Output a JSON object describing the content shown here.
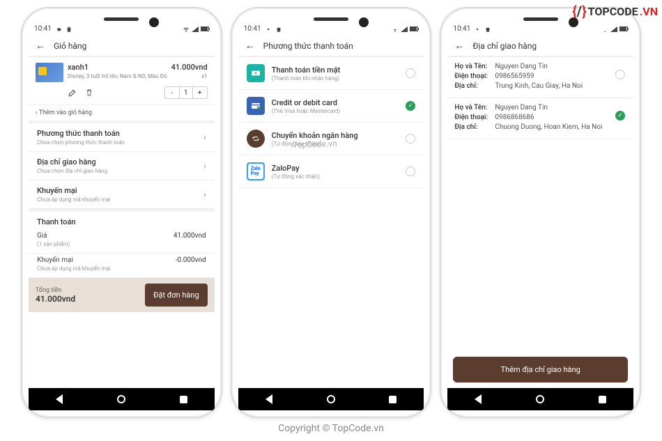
{
  "status": {
    "time": "10:41"
  },
  "watermarks": {
    "brand_name": "TOPCODE",
    "brand_suffix": ".VN",
    "center": "TopCode.vn",
    "footer": "Copyright © TopCode.vn"
  },
  "screen1": {
    "title": "Giỏ hàng",
    "item": {
      "name": "xanh1",
      "desc": "Disney, 3 tuổi trở lên, Nam & Nữ, Màu Đỏ",
      "price": "41.000vnd",
      "qty_label": "x1",
      "qty_value": "1"
    },
    "add_more": "‹   Thêm vào giỏ hàng",
    "options": [
      {
        "title": "Phương thức thanh toán",
        "sub": "Chưa chọn phương thức thanh toán"
      },
      {
        "title": "Địa chỉ giao hàng",
        "sub": "Chưa chọn địa chỉ giao hàng"
      },
      {
        "title": "Khuyến mại",
        "sub": "Chưa áp dụng mã khuyến mại"
      }
    ],
    "payment": {
      "heading": "Thanh toán",
      "price_label": "Giá",
      "price_value": "41.000vnd",
      "price_hint": "(1 sản phẩm)",
      "promo_label": "Khuyến mại",
      "promo_value": "-0.000vnd",
      "promo_hint": "Chưa áp dụng mã khuyến mại"
    },
    "total": {
      "label": "Tổng tiền",
      "value": "41.000vnd",
      "button": "Đặt đơn hàng"
    }
  },
  "screen2": {
    "title": "Phương thức thanh toán",
    "options": [
      {
        "title": "Thanh toán tiền mặt",
        "sub": "(Thanh toán khi nhận hàng)",
        "color": "#1ab3a6",
        "icon": "cash",
        "selected": false
      },
      {
        "title": "Credit or debit card",
        "sub": "(Thẻ Visa hoặc Mastercard)",
        "color": "#3a62b5",
        "icon": "card",
        "selected": true
      },
      {
        "title": "Chuyển khoản ngân hàng",
        "sub": "(Tự động xác nhận)",
        "color": "#5a3d2e",
        "icon": "bank",
        "selected": false
      },
      {
        "title": "ZaloPay",
        "sub": "(Tự động xác nhận)",
        "color": "#36a0f5",
        "icon": "zalo",
        "selected": false
      }
    ]
  },
  "screen3": {
    "title": "Địa chỉ giao hàng",
    "labels": {
      "name": "Họ và Tên:",
      "phone": "Điện thoại:",
      "addr": "Địa chỉ:"
    },
    "addresses": [
      {
        "name": "Nguyen Dang Tin",
        "phone": "0986565959",
        "addr": "Trung Kinh, Cau Giay, Ha Noi",
        "selected": false
      },
      {
        "name": "Nguyen Dang Tin",
        "phone": "0986868686",
        "addr": "Chuong Duong, Hoan Kiem, Ha Noi",
        "selected": true
      }
    ],
    "add_button": "Thêm địa chỉ giao hàng"
  }
}
